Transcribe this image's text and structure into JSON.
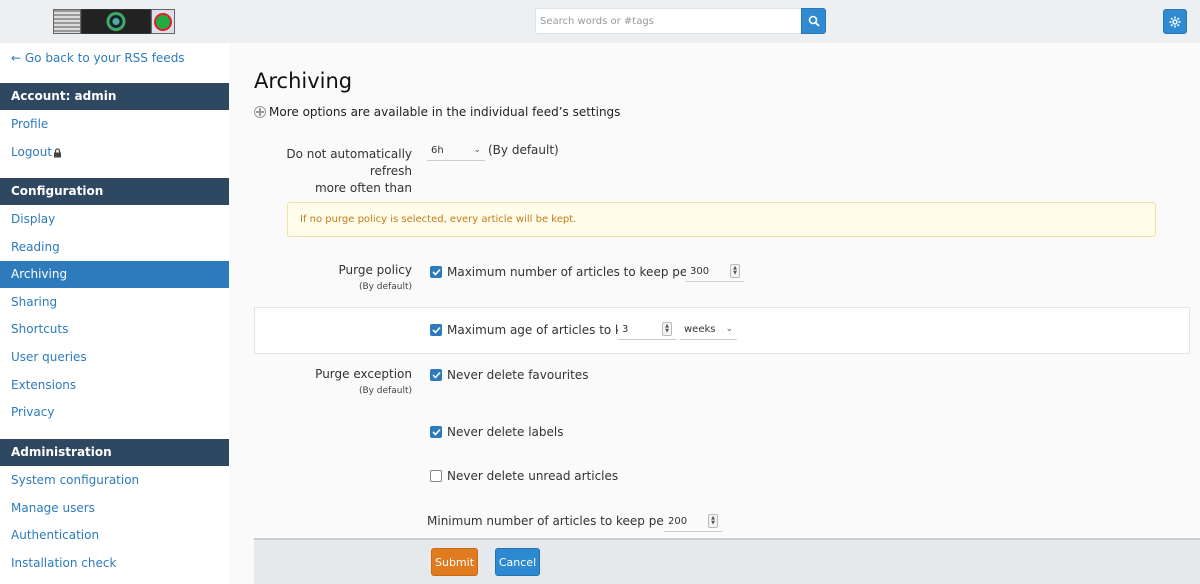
{
  "header": {
    "search_placeholder": "Search words or #tags"
  },
  "sidebar": {
    "back_link": "← Go back to your RSS feeds",
    "sections": [
      {
        "title": "Account: admin",
        "items": [
          "Profile",
          "Logout"
        ]
      },
      {
        "title": "Configuration",
        "items": [
          "Display",
          "Reading",
          "Archiving",
          "Sharing",
          "Shortcuts",
          "User queries",
          "Extensions",
          "Privacy"
        ]
      },
      {
        "title": "Administration",
        "items": [
          "System configuration",
          "Manage users",
          "Authentication",
          "Installation check"
        ]
      }
    ],
    "active_item": "Archiving"
  },
  "main": {
    "title": "Archiving",
    "info": "More options are available in the individual feed’s settings",
    "refresh": {
      "label_line1": "Do not automatically refresh",
      "label_line2": "more often than",
      "value": "6h",
      "suffix": "(By default)"
    },
    "alert": "If no purge policy is selected, every article will be kept.",
    "purge_policy": {
      "label": "Purge policy",
      "sublabel": "(By default)",
      "max_articles_label": "Maximum number of articles to keep per feed",
      "max_articles_checked": true,
      "max_articles_value": "300",
      "max_age_label": "Maximum age of articles to keep",
      "max_age_checked": true,
      "max_age_value": "3",
      "max_age_unit": "weeks"
    },
    "purge_exception": {
      "label": "Purge exception",
      "sublabel": "(By default)",
      "favourites_label": "Never delete favourites",
      "favourites_checked": true,
      "labels_label": "Never delete labels",
      "labels_checked": true,
      "unread_label": "Never delete unread articles",
      "unread_checked": false,
      "min_articles_label": "Minimum number of articles to keep per feed",
      "min_articles_value": "200"
    },
    "buttons": {
      "submit": "Submit",
      "cancel": "Cancel"
    }
  },
  "colors": {
    "accent": "#2d7bbd",
    "sidebar_section": "#2f4862",
    "submit": "#e07b1f",
    "alert_text": "#c47a1c"
  }
}
